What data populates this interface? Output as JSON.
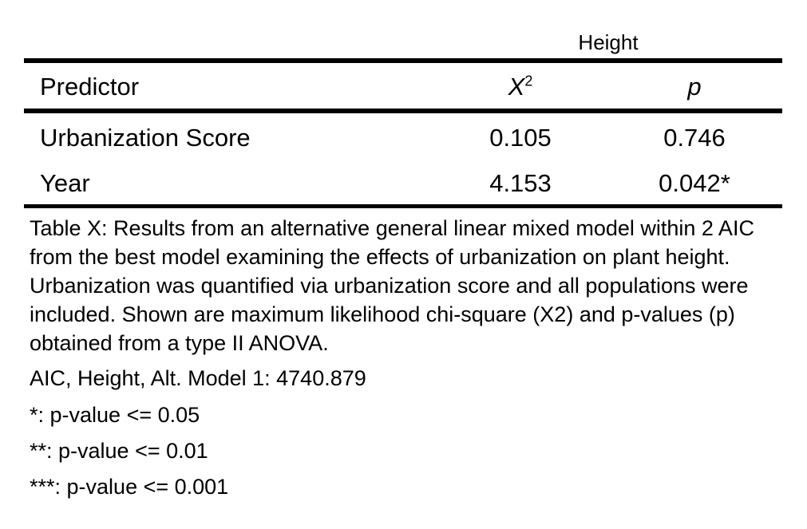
{
  "table": {
    "group_header": "Height",
    "columns": {
      "predictor": "Predictor",
      "chi_square_symbol": "X",
      "chi_square_superscript": "2",
      "p": "p"
    },
    "rows": [
      {
        "predictor": "Urbanization Score",
        "chi_square": "0.105",
        "p": "0.746"
      },
      {
        "predictor": "Year",
        "chi_square": "4.153",
        "p": "0.042*"
      }
    ]
  },
  "caption": "Table X: Results from an alternative general linear mixed model within 2 AIC from the best model examining the effects of urbanization on plant height. Urbanization was quantified via urbanization score and all populations were included. Shown are maximum likelihood chi-square (X2) and p-values (p) obtained from a type II ANOVA.",
  "notes": [
    "AIC, Height, Alt. Model 1: 4740.879",
    "*: p-value <= 0.05",
    "**: p-value <= 0.01",
    "***: p-value <= 0.001"
  ]
}
